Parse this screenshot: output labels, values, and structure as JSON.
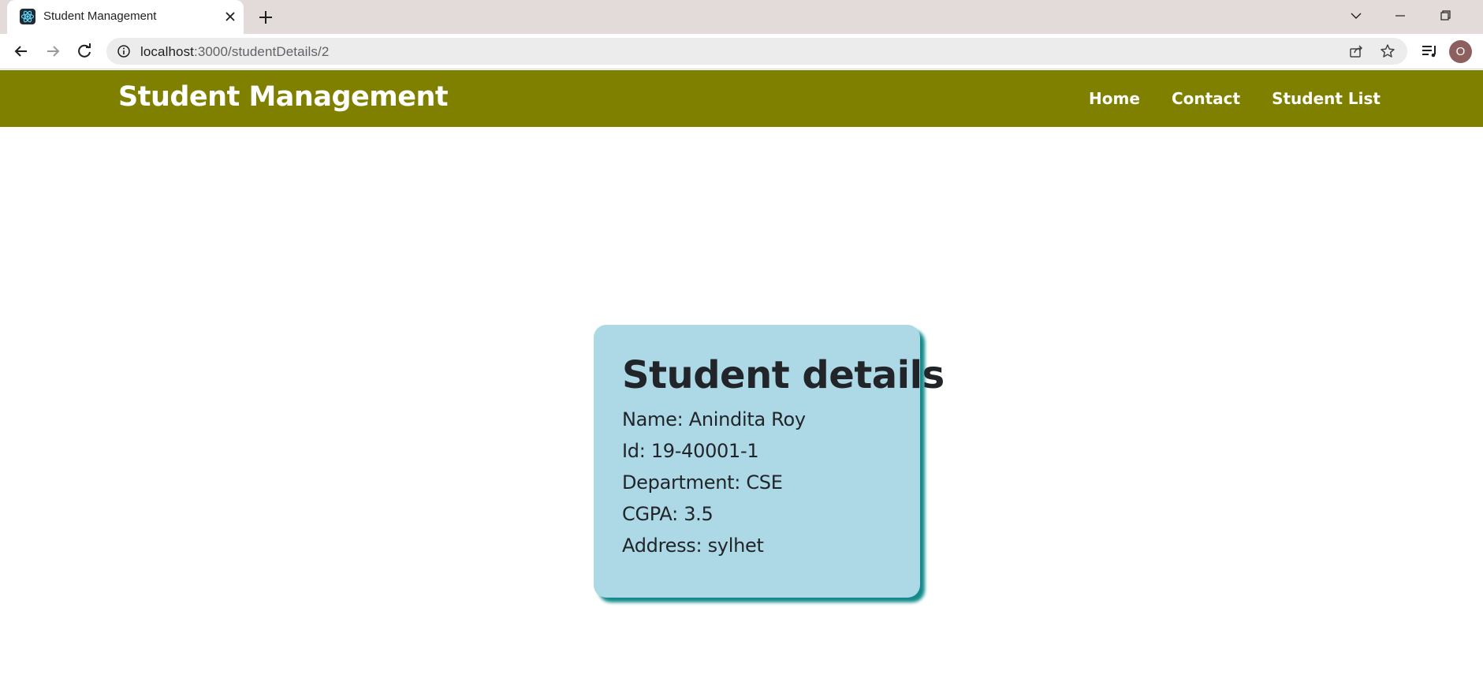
{
  "browser": {
    "tab_title": "Student Management",
    "url_host": "localhost",
    "url_path": ":3000/studentDetails/2",
    "profile_initial": "O",
    "icons": [
      "react-favicon-icon",
      "close-icon",
      "plus-icon",
      "chevron-down-icon",
      "minimize-icon",
      "restore-icon",
      "back-arrow-icon",
      "forward-arrow-icon",
      "reload-icon",
      "info-icon",
      "share-icon",
      "star-icon",
      "reading-list-icon"
    ]
  },
  "navbar": {
    "brand": "Student Management",
    "links": [
      "Home",
      "Contact",
      "Student List"
    ],
    "background": "#808000"
  },
  "card": {
    "title": "Student details",
    "name": "Name: Anindita Roy",
    "id": "Id: 19-40001-1",
    "department": "Department: CSE",
    "cgpa": "CGPA: 3.5",
    "address": "Address: sylhet",
    "background": "#add8e6",
    "shadow": "#138a8a"
  }
}
